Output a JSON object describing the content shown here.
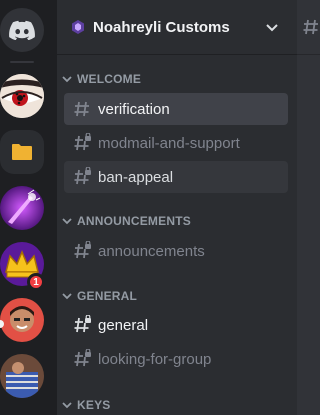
{
  "server": {
    "name": "Noahreyli Customs",
    "badge_count": "1"
  },
  "categories": [
    {
      "label": "WELCOME",
      "channels": [
        {
          "name": "verification",
          "state": "active",
          "locked": false
        },
        {
          "name": "modmail-and-support",
          "state": "normal",
          "locked": true
        },
        {
          "name": "ban-appeal",
          "state": "hover",
          "locked": true
        }
      ]
    },
    {
      "label": "ANNOUNCEMENTS",
      "channels": [
        {
          "name": "announcements",
          "state": "normal",
          "locked": true
        }
      ]
    },
    {
      "label": "GENERAL",
      "channels": [
        {
          "name": "general",
          "state": "unread",
          "locked": false
        },
        {
          "name": "looking-for-group",
          "state": "normal",
          "locked": true
        }
      ]
    },
    {
      "label": "KEYS",
      "channels": []
    }
  ],
  "colors": {
    "accent": "#5865f2",
    "folder": "#f0b232",
    "badge": "#f23f43"
  },
  "icons": {
    "home": "discord-logo-icon",
    "folder": "folder-icon",
    "chevron": "chevron-down-icon",
    "channel": "hashtag-icon",
    "locked_channel": "hashtag-lock-icon"
  }
}
